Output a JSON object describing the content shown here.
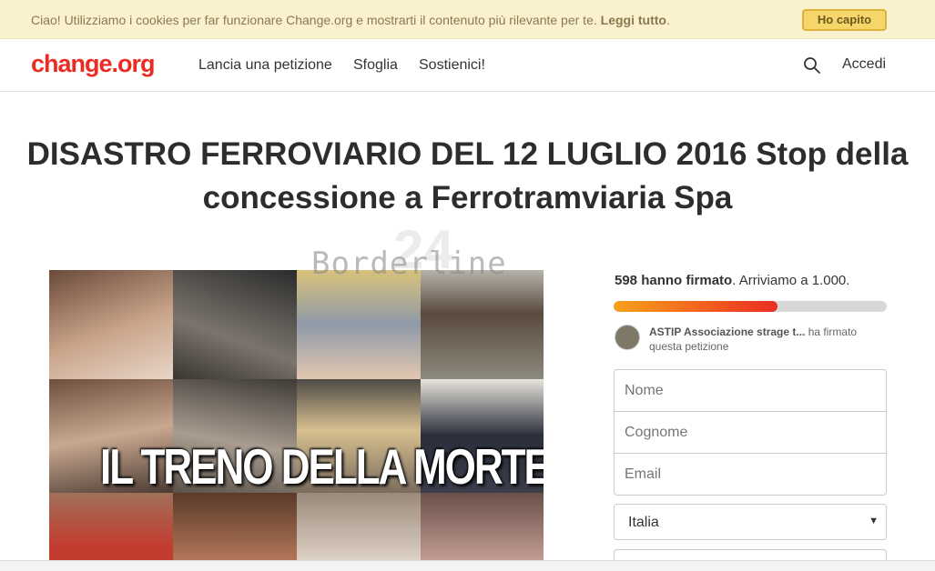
{
  "cookie_bar": {
    "message": "Ciao! Utilizziamo i cookies per far funzionare Change.org e mostrarti il contenuto più rilevante per te.",
    "read_more": "Leggi tutto",
    "suffix": ".",
    "accept_label": "Ho capito"
  },
  "header": {
    "logo": "change.org",
    "nav": [
      "Lancia una petizione",
      "Sfoglia",
      "Sostienici!"
    ],
    "search_icon": "search-icon",
    "login_label": "Accedi"
  },
  "petition": {
    "title": "DISASTRO FERROVIARIO DEL 12 LUGLIO 2016 Stop della concessione a Ferrotramviaria Spa",
    "watermark_text": "Borderline",
    "watermark_number": "24",
    "image_caption": "IL TRENO DELLA MORTE"
  },
  "sidebar": {
    "signatures_count": "598 hanno firmato",
    "signatures_goal": ". Arriviamo a 1.000.",
    "progress": 0.6,
    "recent_signer_name": "ASTIP Associazione strage t...",
    "recent_signer_action": " ha firmato questa petizione",
    "form": {
      "first_name_placeholder": "Nome",
      "last_name_placeholder": "Cognome",
      "email_placeholder": "Email",
      "country_value": "Italia"
    }
  },
  "colors": {
    "brand": "#ec2c22",
    "cookie_bg": "#faf1cf",
    "cookie_button": "#f6d56a"
  }
}
